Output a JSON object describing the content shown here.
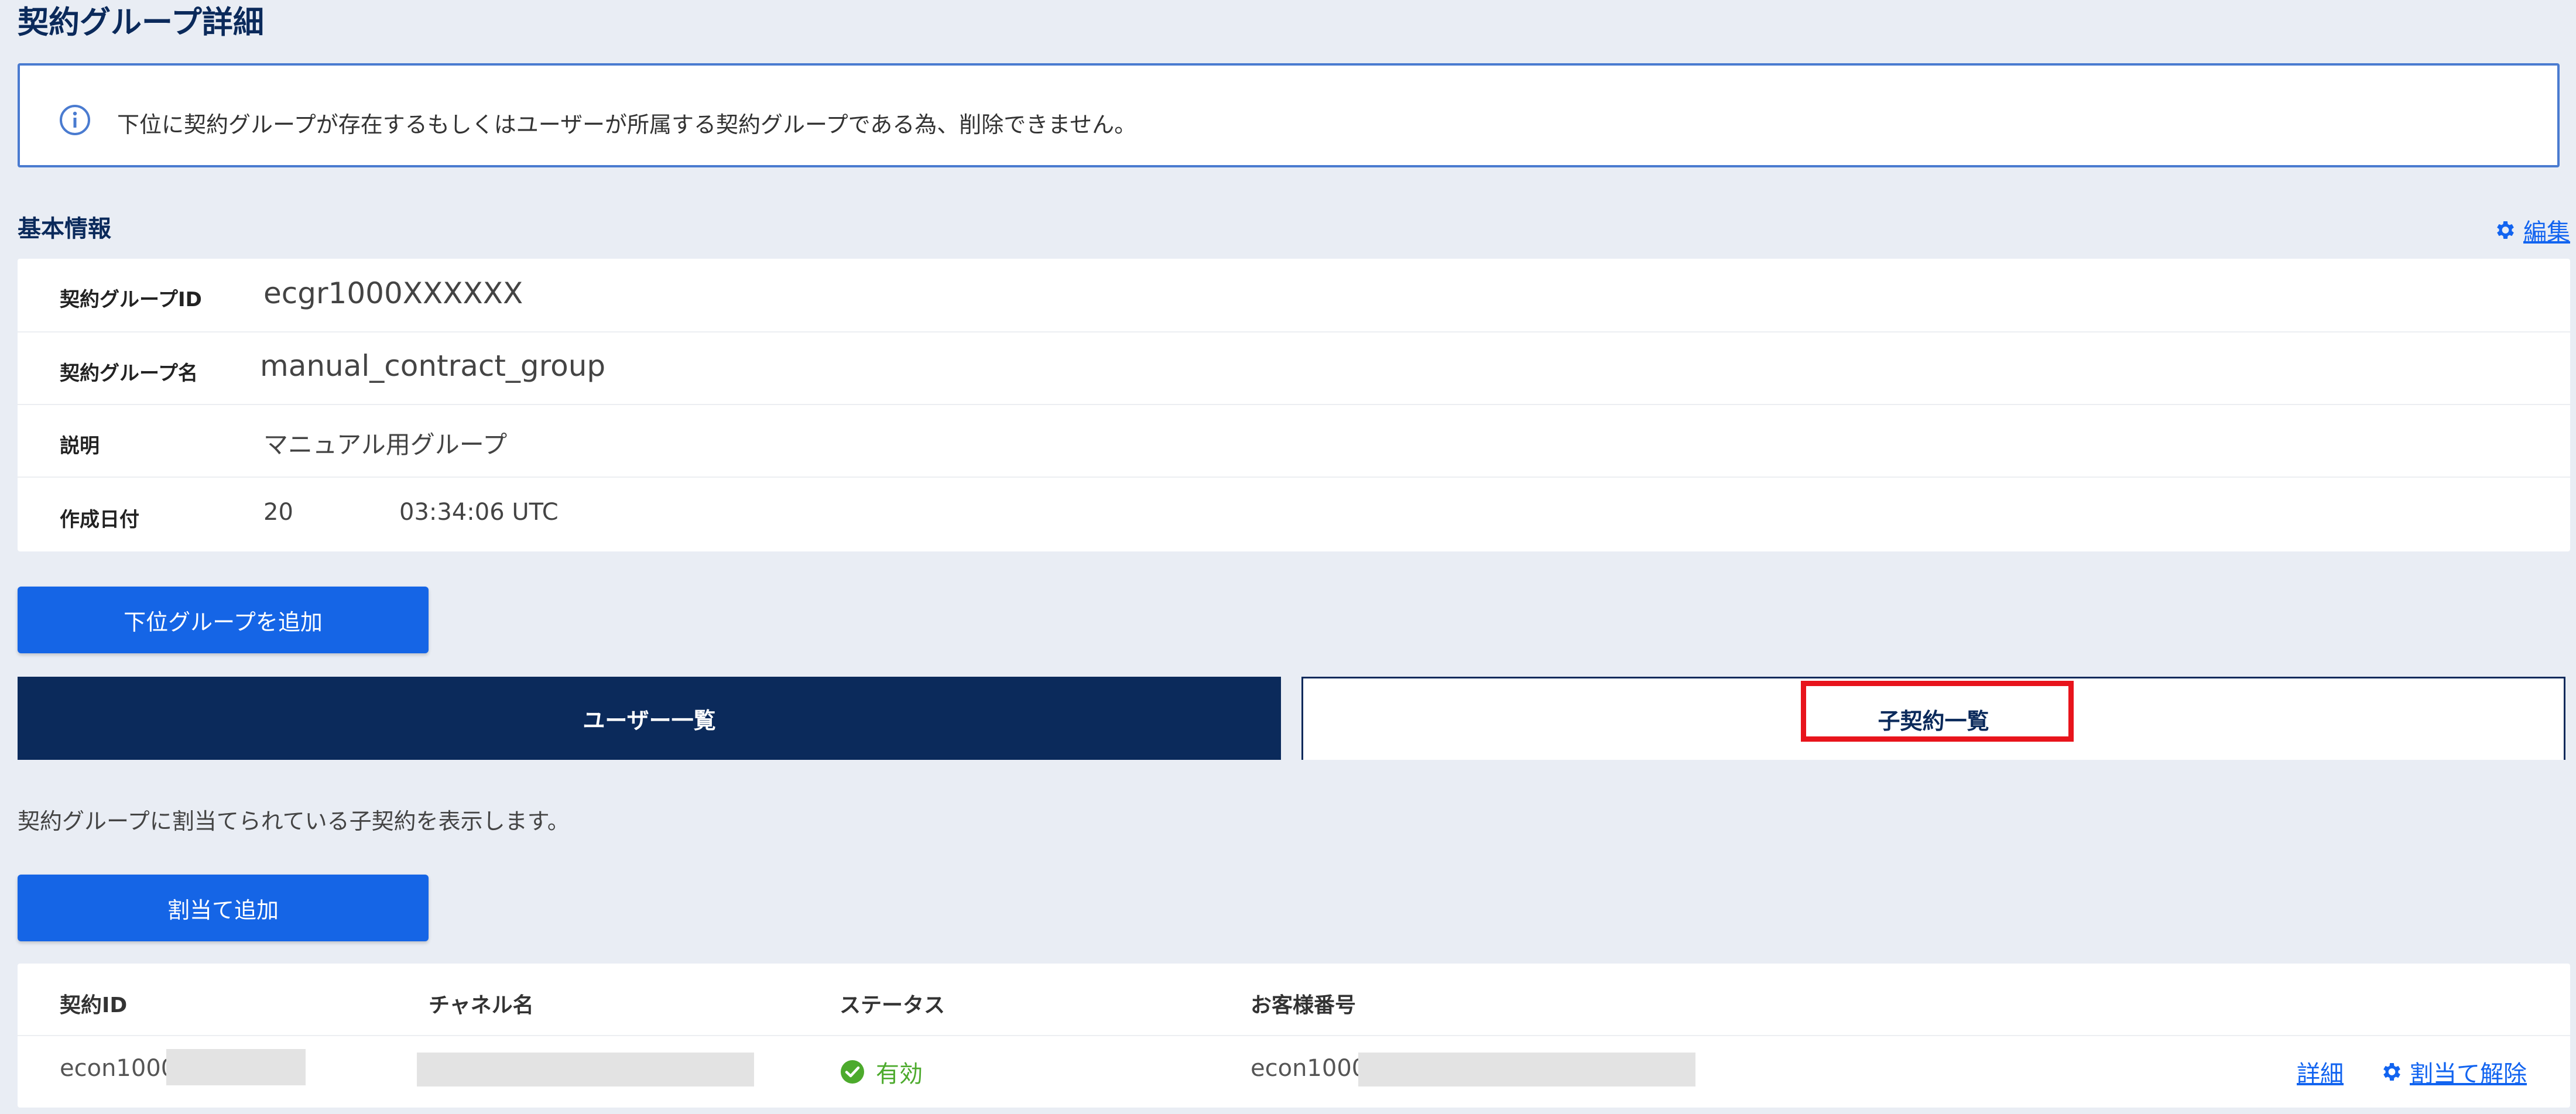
{
  "page": {
    "title": "契約グループ詳細"
  },
  "notice": {
    "text": "下位に契約グループが存在するもしくはユーザーが所属する契約グループである為、削除できません。"
  },
  "basic_info": {
    "section_title": "基本情報",
    "edit_label": "編集",
    "rows": [
      {
        "label": "契約グループID",
        "value": "ecgr1000XXXXXX"
      },
      {
        "label": "契約グループ名",
        "value": "manual_contract_group"
      },
      {
        "label": "説明",
        "value": "マニュアル用グループ"
      },
      {
        "label": "作成日付",
        "value_prefix": "20",
        "value_suffix": "03:34:06 UTC"
      }
    ]
  },
  "add_subgroup_button": "下位グループを追加",
  "tabs": [
    {
      "label": "ユーザー一覧",
      "active": true
    },
    {
      "label": "子契約一覧",
      "active": false
    }
  ],
  "description": "契約グループに割当てられている子契約を表示します。",
  "assign_add_button": "割当て追加",
  "table": {
    "headers": [
      "契約ID",
      "チャネル名",
      "ステータス",
      "お客様番号"
    ],
    "rows": [
      {
        "contract_id": "econ1000",
        "status": "有効",
        "customer_no": "econ1000",
        "detail_link": "詳細",
        "unassign_link": "割当て解除"
      }
    ]
  },
  "colors": {
    "accent": "#1565e6",
    "navy": "#0b2a5b",
    "success": "#4caa2c",
    "highlight": "#e8141c"
  }
}
